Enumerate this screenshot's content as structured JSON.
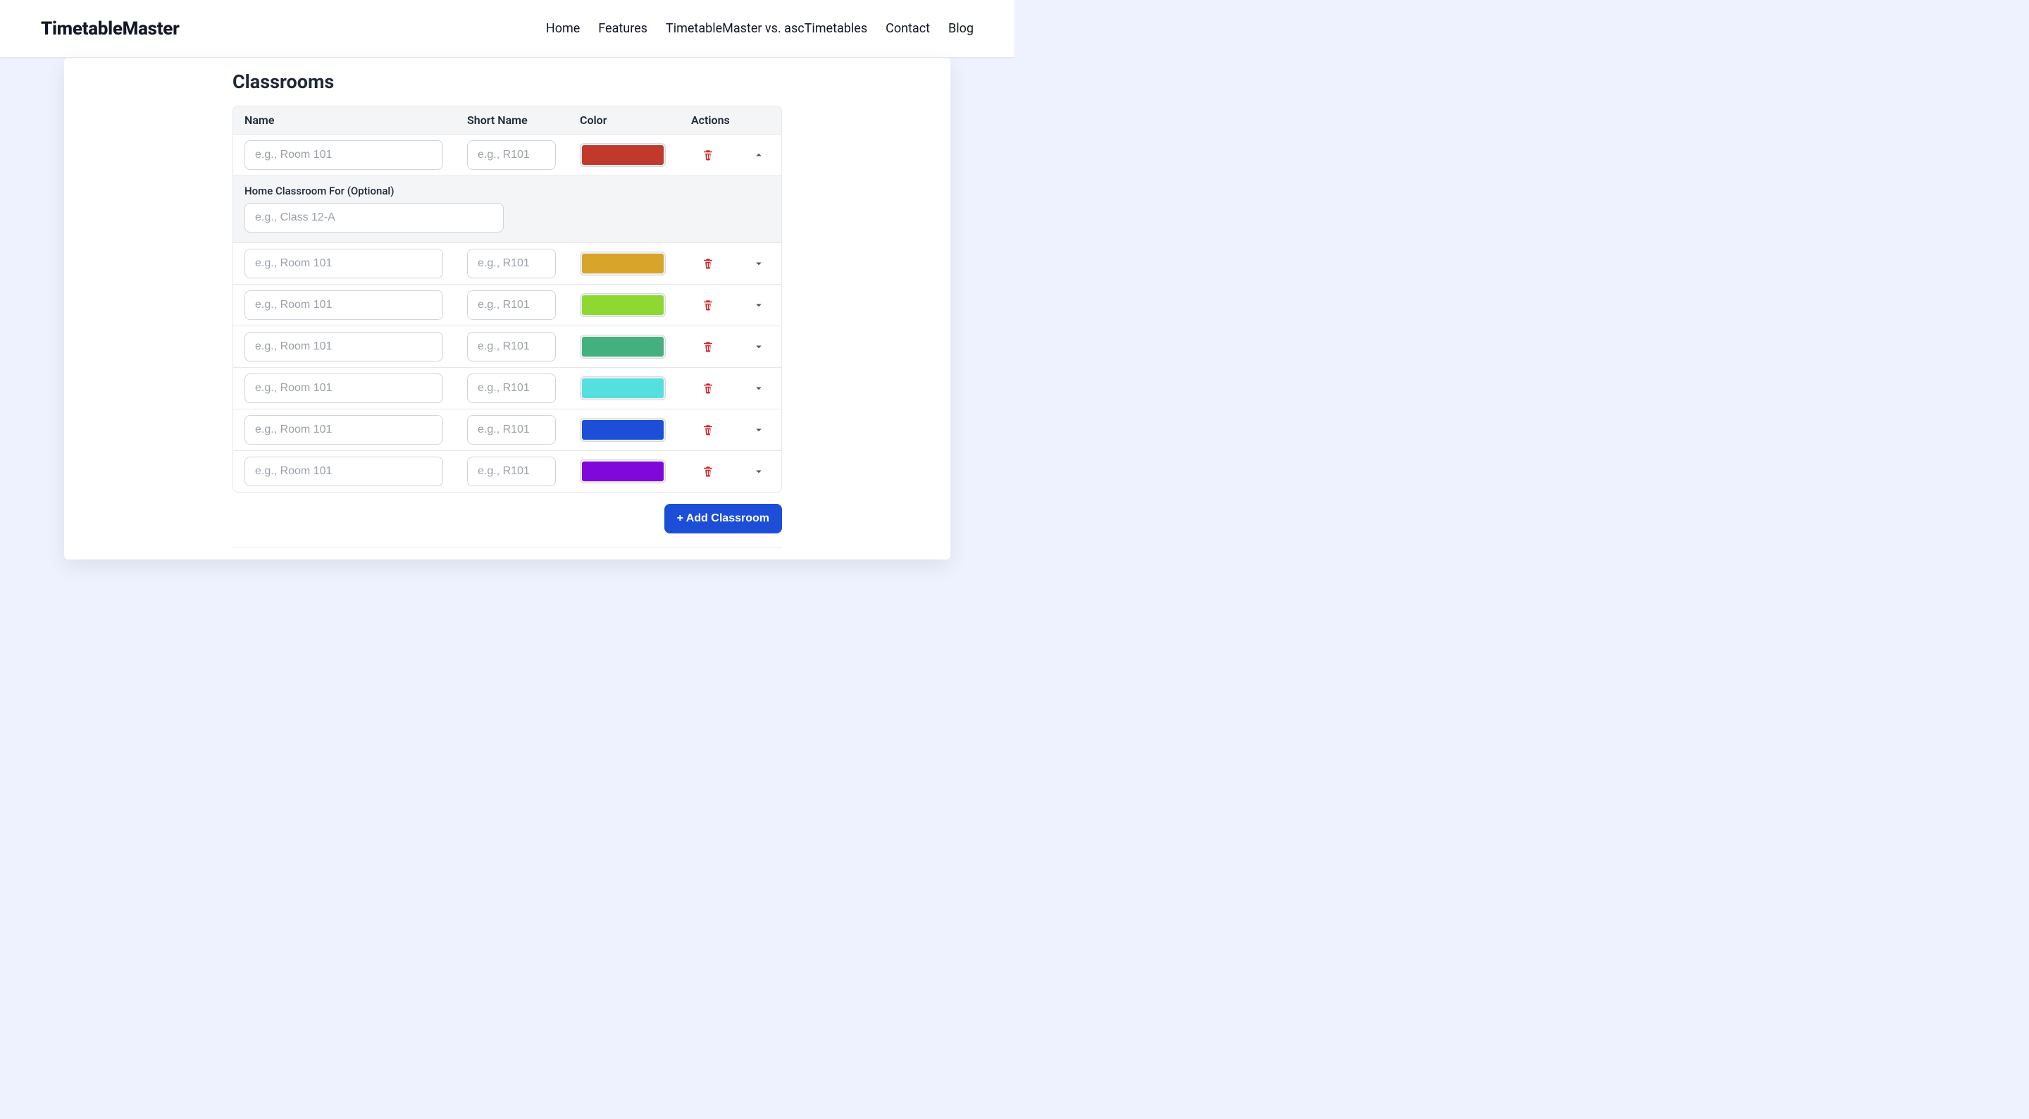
{
  "brand": "TimetableMaster",
  "nav": {
    "home": "Home",
    "features": "Features",
    "compare": "TimetableMaster vs. ascTimetables",
    "contact": "Contact",
    "blog": "Blog"
  },
  "section": {
    "title": "Classrooms"
  },
  "table": {
    "headers": {
      "name": "Name",
      "short": "Short Name",
      "color": "Color",
      "actions": "Actions"
    },
    "name_placeholder": "e.g., Room 101",
    "short_placeholder": "e.g., R101",
    "expanded": {
      "label": "Home Classroom For (Optional)",
      "placeholder": "e.g., Class 12-A"
    },
    "rows": [
      {
        "name": "",
        "short": "",
        "color": "#c0392b",
        "expanded": true
      },
      {
        "name": "",
        "short": "",
        "color": "#d8a42a",
        "expanded": false
      },
      {
        "name": "",
        "short": "",
        "color": "#8fd832",
        "expanded": false
      },
      {
        "name": "",
        "short": "",
        "color": "#43b07d",
        "expanded": false
      },
      {
        "name": "",
        "short": "",
        "color": "#55e0df",
        "expanded": false
      },
      {
        "name": "",
        "short": "",
        "color": "#1d4ed8",
        "expanded": false
      },
      {
        "name": "",
        "short": "",
        "color": "#8008db",
        "expanded": false
      }
    ]
  },
  "buttons": {
    "add": "+ Add Classroom"
  }
}
